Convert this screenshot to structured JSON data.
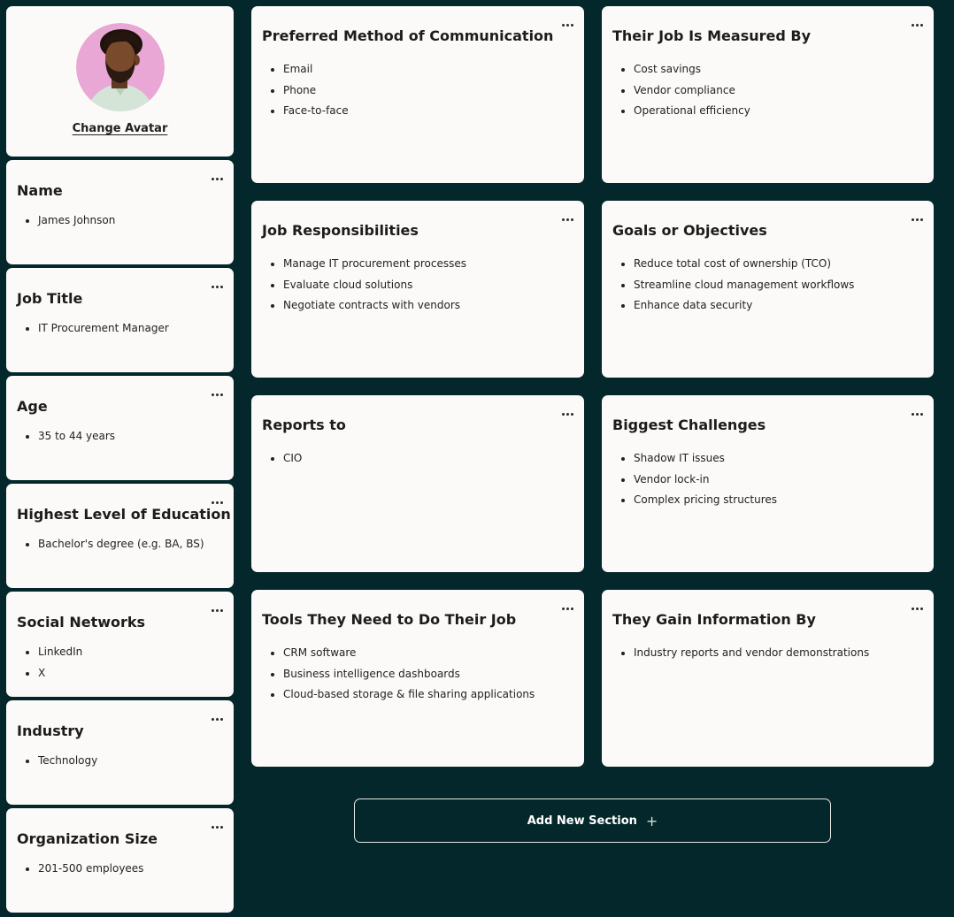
{
  "avatar": {
    "change_label": "Change Avatar",
    "background_color": "#e8a7d4"
  },
  "left_cards": [
    {
      "title": "Name",
      "items": [
        "James Johnson"
      ]
    },
    {
      "title": "Job Title",
      "items": [
        "IT Procurement Manager"
      ]
    },
    {
      "title": "Age",
      "items": [
        "35 to 44 years"
      ]
    },
    {
      "title": "Highest Level of Education",
      "items": [
        "Bachelor's degree (e.g. BA, BS)"
      ]
    },
    {
      "title": "Social Networks",
      "items": [
        "LinkedIn",
        "X"
      ]
    },
    {
      "title": "Industry",
      "items": [
        "Technology"
      ]
    },
    {
      "title": "Organization Size",
      "items": [
        "201-500 employees"
      ]
    }
  ],
  "grid_cards": [
    {
      "title": "Preferred Method of Communication",
      "items": [
        "Email",
        "Phone",
        "Face-to-face"
      ]
    },
    {
      "title": "Their Job Is Measured By",
      "items": [
        "Cost savings",
        "Vendor compliance",
        "Operational efficiency"
      ]
    },
    {
      "title": "Job Responsibilities",
      "items": [
        "Manage IT procurement processes",
        "Evaluate cloud solutions",
        "Negotiate contracts with vendors"
      ]
    },
    {
      "title": "Goals or Objectives",
      "items": [
        "Reduce total cost of ownership (TCO)",
        "Streamline cloud management workflows",
        "Enhance data security"
      ]
    },
    {
      "title": "Reports to",
      "items": [
        "CIO"
      ]
    },
    {
      "title": "Biggest Challenges",
      "items": [
        "Shadow IT issues",
        "Vendor lock-in",
        "Complex pricing structures"
      ]
    },
    {
      "title": "Tools They Need to Do Their Job",
      "items": [
        "CRM software",
        "Business intelligence dashboards",
        "Cloud-based storage & file sharing applications"
      ]
    },
    {
      "title": "They Gain Information By",
      "items": [
        "Industry reports and vendor demonstrations"
      ]
    }
  ],
  "add_section": {
    "label": "Add New Section",
    "icon": "plus-icon"
  },
  "colors": {
    "page_background": "#03272a",
    "card_background": "#fbfaf8"
  }
}
